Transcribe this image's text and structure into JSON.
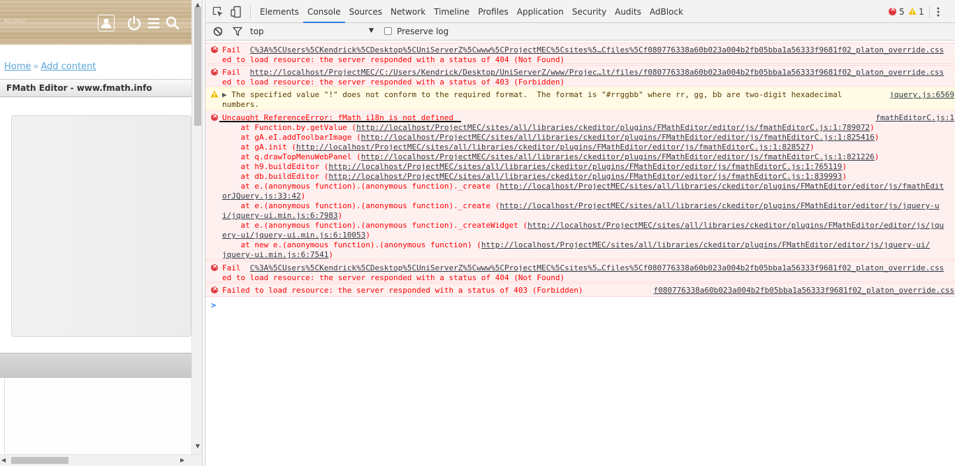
{
  "page": {
    "logo_text": "BCSMEC",
    "breadcrumb": {
      "home": "Home",
      "separator": "»",
      "add_content": "Add content"
    },
    "editor_title": "FMath Editor - www.fmath.info",
    "icons": [
      "user-icon",
      "power-icon",
      "menu-icon",
      "search-icon"
    ]
  },
  "devtools": {
    "tabs": [
      "Elements",
      "Console",
      "Sources",
      "Network",
      "Timeline",
      "Profiles",
      "Application",
      "Security",
      "Audits",
      "AdBlock"
    ],
    "active_tab": "Console",
    "error_count": "5",
    "warning_count": "1",
    "context": "top",
    "preserve_log_label": "Preserve log",
    "colors": {
      "error": "#ff0000",
      "error_bg": "#fff0f0",
      "warn_bg": "#fffbe5",
      "link": "#303942",
      "active_tab": "#3879d9"
    }
  },
  "console": {
    "messages": [
      {
        "level": "error",
        "lines": [
          {
            "prefix": "Fail  ",
            "url": "C%3A%5CUsers%5CKendrick%5CDesktop%5CUniServerZ%5Cwww%5CProjectMEC%5Csites%5…Cfiles%5Cf080776338a60b023a004b2fb05bba1a56333f9681f02_platon_override.css"
          },
          {
            "text": "ed to load resource: the server responded with a status of 404 (Not Found)"
          }
        ]
      },
      {
        "level": "error",
        "lines": [
          {
            "prefix": "Fail  ",
            "url": "http://localhost/ProjectMEC/C:/Users/Kendrick/Desktop/UniServerZ/www/Projec…lt/files/f080776338a60b023a004b2fb05bba1a56333f9681f02_platon_override.css"
          },
          {
            "text": "ed to load resource: the server responded with a status of 403 (Forbidden)"
          }
        ]
      },
      {
        "level": "warn",
        "lines": [
          {
            "text": "The specified value \"!\" does not conform to the required format.  The format is \"#rrggbb\" where rr, gg, bb are two-digit hexadecimal"
          },
          {
            "text": "numbers."
          }
        ],
        "source": "jquery.js:6569"
      },
      {
        "level": "error",
        "headline": "Uncaught ReferenceError: fMath_i18n is not defined",
        "source": "fmathEditorC.js:1",
        "stack": [
          {
            "prefix": "    at Function.by.getValue (",
            "url": "http://localhost/ProjectMEC/sites/all/libraries/ckeditor/plugins/FMathEditor/editor/js/fmathEditorC.js:1:789072",
            "suffix": ")"
          },
          {
            "prefix": "    at gA.eI.addToolbarImage (",
            "url": "http://localhost/ProjectMEC/sites/all/libraries/ckeditor/plugins/FMathEditor/editor/js/fmathEditorC.js:1:825416",
            "suffix": ")"
          },
          {
            "prefix": "    at gA.init (",
            "url": "http://localhost/ProjectMEC/sites/all/libraries/ckeditor/plugins/FMathEditor/editor/js/fmathEditorC.js:1:828527",
            "suffix": ")"
          },
          {
            "prefix": "    at q.drawTopMenuWebPanel (",
            "url": "http://localhost/ProjectMEC/sites/all/libraries/ckeditor/plugins/FMathEditor/editor/js/fmathEditorC.js:1:821226",
            "suffix": ")"
          },
          {
            "prefix": "    at h9.buildEditor (",
            "url": "http://localhost/ProjectMEC/sites/all/libraries/ckeditor/plugins/FMathEditor/editor/js/fmathEditorC.js:1:765119",
            "suffix": ")"
          },
          {
            "prefix": "    at db.buildEditor (",
            "url": "http://localhost/ProjectMEC/sites/all/libraries/ckeditor/plugins/FMathEditor/editor/js/fmathEditorC.js:1:839993",
            "suffix": ")"
          },
          {
            "prefix": "    at e.(anonymous function).(anonymous function)._create (",
            "url": "http://localhost/ProjectMEC/sites/all/libraries/ckeditor/plugins/FMathEditor/editor/js/fmathEdit",
            "suffix": ""
          },
          {
            "prefix": "",
            "url": "orJQuery.js:33:42",
            "suffix": ")"
          },
          {
            "prefix": "    at e.(anonymous function).(anonymous function)._create (",
            "url": "http://localhost/ProjectMEC/sites/all/libraries/ckeditor/plugins/FMathEditor/editor/js/jquery-u",
            "suffix": ""
          },
          {
            "prefix": "",
            "url": "i/jquery-ui.min.js:6:7983",
            "suffix": ")"
          },
          {
            "prefix": "    at e.(anonymous function).(anonymous function)._createWidget (",
            "url": "http://localhost/ProjectMEC/sites/all/libraries/ckeditor/plugins/FMathEditor/editor/js/jqu",
            "suffix": ""
          },
          {
            "prefix": "",
            "url": "ery-ui/jquery-ui.min.js:6:10053",
            "suffix": ")"
          },
          {
            "prefix": "    at new e.(anonymous function).(anonymous function) (",
            "url": "http://localhost/ProjectMEC/sites/all/libraries/ckeditor/plugins/FMathEditor/editor/js/jquery-ui/",
            "suffix": ""
          },
          {
            "prefix": "",
            "url": "jquery-ui.min.js:6:7541",
            "suffix": ")"
          }
        ]
      },
      {
        "level": "error",
        "lines": [
          {
            "prefix": "Fail  ",
            "url": "C%3A%5CUsers%5CKendrick%5CDesktop%5CUniServerZ%5Cwww%5CProjectMEC%5Csites%5…Cfiles%5Cf080776338a60b023a004b2fb05bba1a56333f9681f02_platon_override.css"
          },
          {
            "text": "ed to load resource: the server responded with a status of 404 (Not Found)"
          }
        ]
      },
      {
        "level": "error",
        "lines": [
          {
            "text": "Failed to load resource: the server responded with a status of 403 (Forbidden)"
          }
        ],
        "source": "f080776338a60b023a004b2fb05bba1a56333f9681f02_platon_override.css"
      }
    ],
    "prompt_symbol": ">"
  }
}
